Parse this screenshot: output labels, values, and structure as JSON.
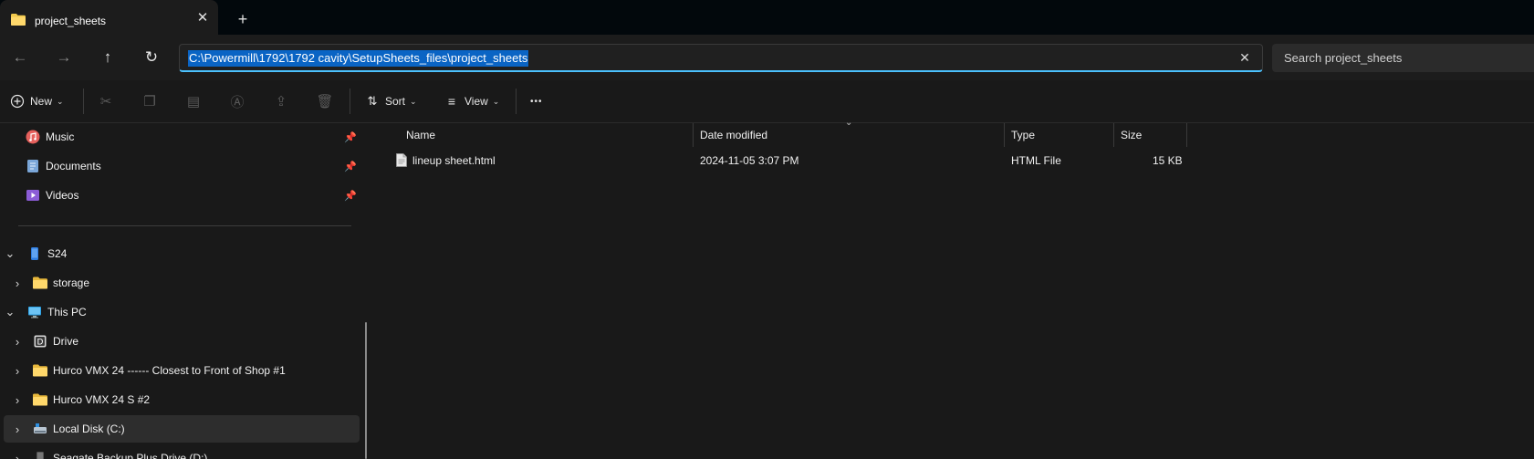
{
  "tab": {
    "title": "project_sheets",
    "close_glyph": "✕",
    "new_glyph": "+"
  },
  "address": {
    "path": "C:\\Powermill\\1792\\1792 cavity\\SetupSheets_files\\project_sheets",
    "clear_glyph": "✕"
  },
  "search": {
    "placeholder": "Search project_sheets"
  },
  "nav": {
    "back": "←",
    "forward": "→",
    "up": "↑",
    "refresh": "↻"
  },
  "toolbar": {
    "new_label": "New",
    "sort_label": "Sort",
    "view_label": "View",
    "more_glyph": "•••"
  },
  "sidebar": {
    "quick_access": [
      {
        "label": "Music",
        "icon": "music-icon"
      },
      {
        "label": "Documents",
        "icon": "documents-icon"
      },
      {
        "label": "Videos",
        "icon": "videos-icon"
      }
    ],
    "tree": [
      {
        "label": "S24",
        "icon": "phone-icon",
        "expanded": true
      },
      {
        "label": "storage",
        "icon": "folder-icon",
        "expanded": false
      },
      {
        "label": "This PC",
        "icon": "pc-icon",
        "expanded": true
      },
      {
        "label": "Drive",
        "icon": "drive-icon",
        "expanded": false
      },
      {
        "label": "Hurco VMX 24 ------ Closest to Front of Shop #1",
        "icon": "folder-icon",
        "expanded": false
      },
      {
        "label": "Hurco VMX 24 S #2",
        "icon": "folder-icon",
        "expanded": false
      },
      {
        "label": "Local Disk (C:)",
        "icon": "local-disk-icon",
        "expanded": false,
        "selected": true
      },
      {
        "label": "Seagate Backup Plus Drive (D:)",
        "icon": "external-drive-icon",
        "expanded": false
      }
    ]
  },
  "columns": {
    "name": "Name",
    "date": "Date modified",
    "type": "Type",
    "size": "Size"
  },
  "files": [
    {
      "name": "lineup sheet.html",
      "date": "2024-11-05 3:07 PM",
      "type": "HTML File",
      "size": "15 KB"
    }
  ],
  "colors": {
    "accent": "#4cc2ff",
    "selection": "#0a64c4",
    "folder": "#f2c94c"
  }
}
